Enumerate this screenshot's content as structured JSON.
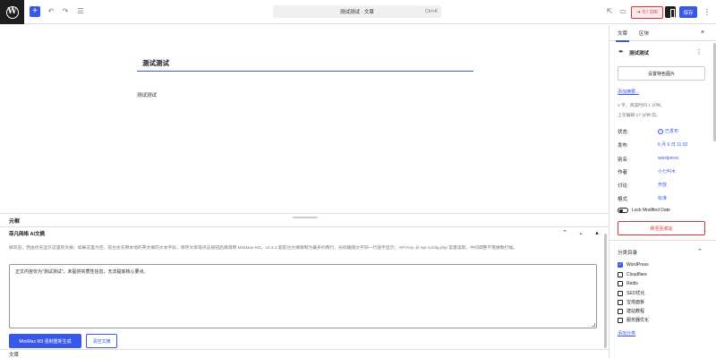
{
  "topbar": {
    "logo": "W",
    "add_icon": "+",
    "undo_icon": "↶",
    "redo_icon": "↷",
    "outline_icon": "☰",
    "command_title": "测试测试 · 文章",
    "command_shortcut": "Ctrl+K",
    "external_icon": "⇱",
    "device_icon": "▭",
    "seo_badge_icon": "➔",
    "seo_badge": "0 / 100",
    "save_label": "保存",
    "more_icon": "⋮"
  },
  "editor": {
    "title": "测试测试",
    "paragraph": "测试测试"
  },
  "meta": {
    "header": "元框",
    "ai_box_title": "菲凡网络 AI文摘",
    "ai_up_icon": "⌃",
    "ai_down_icon": "⌄",
    "ai_toggle_icon": "▴",
    "ai_description": "摘写后，若由优先显示这里的文摘；如果这里为空，前台会先用本地的英文摘的文本字段，保存文章或点击按钮后再调用 MiniMax-M3，v2.4.2 起前台文摘限制为最多约两行，光标跟随文字同一行逐字显示；API Key 从 wp-config.php 常量读取，中间调整不需做数打幅。",
    "ai_text": "正文内容仅为\"测试测试\"，未提供实质性信息，无法提炼核心要点。",
    "generate_label": "MiniMax M3 强制重新生成",
    "clear_label": "清空文摘",
    "footer_breadcrumb": "文章"
  },
  "sidebar": {
    "tab_post": "文章",
    "tab_block": "区块",
    "close_icon": "×",
    "doc_icon": "✒",
    "doc_title": "测试测试",
    "more_icon": "⋮",
    "featured_image_label": "设置特色图片",
    "excerpt_link": "添加摘要...",
    "word_info": "4 字，阅读时间 1 分钟。",
    "edit_info": "上次编辑 17 分钟 前。",
    "rows": [
      {
        "label": "状态",
        "value": "已发布"
      },
      {
        "label": "发布",
        "value": "6 月 6 日 11:02"
      },
      {
        "label": "别名",
        "value": "wordpress"
      },
      {
        "label": "作者",
        "value": "小七叫木"
      },
      {
        "label": "讨论",
        "value": "开放"
      },
      {
        "label": "格式",
        "value": "标准"
      }
    ],
    "status_icon": "✓",
    "lock_modified_label": "Lock Modified Date",
    "trash_label": "移至回收站",
    "categories_title": "分类目录",
    "categories_chevron": "⌃",
    "check_mark": "✓",
    "categories": [
      {
        "name": "WordPress",
        "checked": true
      },
      {
        "name": "Cloudflare",
        "checked": false
      },
      {
        "name": "Redis",
        "checked": false
      },
      {
        "name": "SEO优化",
        "checked": false
      },
      {
        "name": "宝塔面板",
        "checked": false
      },
      {
        "name": "建站教程",
        "checked": false
      },
      {
        "name": "服务器优化",
        "checked": false
      }
    ],
    "add_category_link": "添加分类"
  }
}
